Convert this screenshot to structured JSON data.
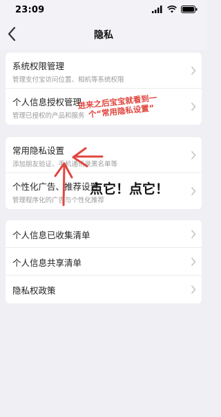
{
  "status_bar": {
    "time": "23:09",
    "icons": [
      "signal-icon",
      "wifi-icon",
      "battery-icon"
    ]
  },
  "nav": {
    "title": "隐私",
    "back_icon": "chevron-left-icon"
  },
  "sections": [
    {
      "items": [
        {
          "label": "系统权限管理",
          "description": "管理支付宝访问位置、相机等系统权限"
        },
        {
          "label": "个人信息授权管理",
          "description": "管理已授权的产品和服务"
        }
      ]
    },
    {
      "items": [
        {
          "label": "常用隐私设置",
          "description": "添加朋友验证、手机通讯录黑名单等"
        },
        {
          "label": "个性化广告、推荐设置",
          "description": "管理程序化的广告与个性化推荐"
        }
      ]
    },
    {
      "items": [
        {
          "label": "个人信息已收集清单"
        },
        {
          "label": "个人信息共享清单"
        },
        {
          "label": "隐私权政策"
        }
      ]
    }
  ],
  "annotations": {
    "note": "进来之后宝宝就看到一个“常用隐私设置”",
    "note_line1": "进来之后宝宝就看到一",
    "note_line2": "个“常用隐私设置”",
    "click_here": "点它！点它！",
    "color": "#e0463f"
  }
}
